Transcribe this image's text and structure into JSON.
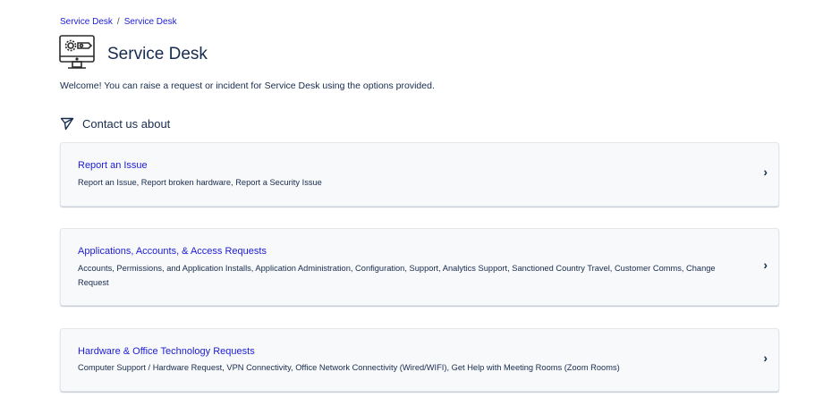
{
  "breadcrumb": [
    "Service Desk",
    "Service Desk"
  ],
  "breadcrumb_sep": "/",
  "header": {
    "title": "Service Desk",
    "welcome": "Welcome! You can raise a request or incident for Service Desk using the options provided."
  },
  "section": {
    "label": "Contact us about"
  },
  "cards": [
    {
      "title": "Report an Issue",
      "desc": "Report an Issue, Report broken hardware, Report a Security Issue"
    },
    {
      "title": "Applications, Accounts, & Access Requests",
      "desc": "Accounts, Permissions, and Application Installs, Application Administration, Configuration, Support, Analytics Support, Sanctioned Country Travel, Customer Comms, Change Request"
    },
    {
      "title": "Hardware & Office Technology Requests",
      "desc": "Computer Support / Hardware Request, VPN Connectivity, Office Network Connectivity (Wired/WIFI), Get Help with Meeting Rooms (Zoom Rooms)"
    }
  ],
  "chevron": "›"
}
